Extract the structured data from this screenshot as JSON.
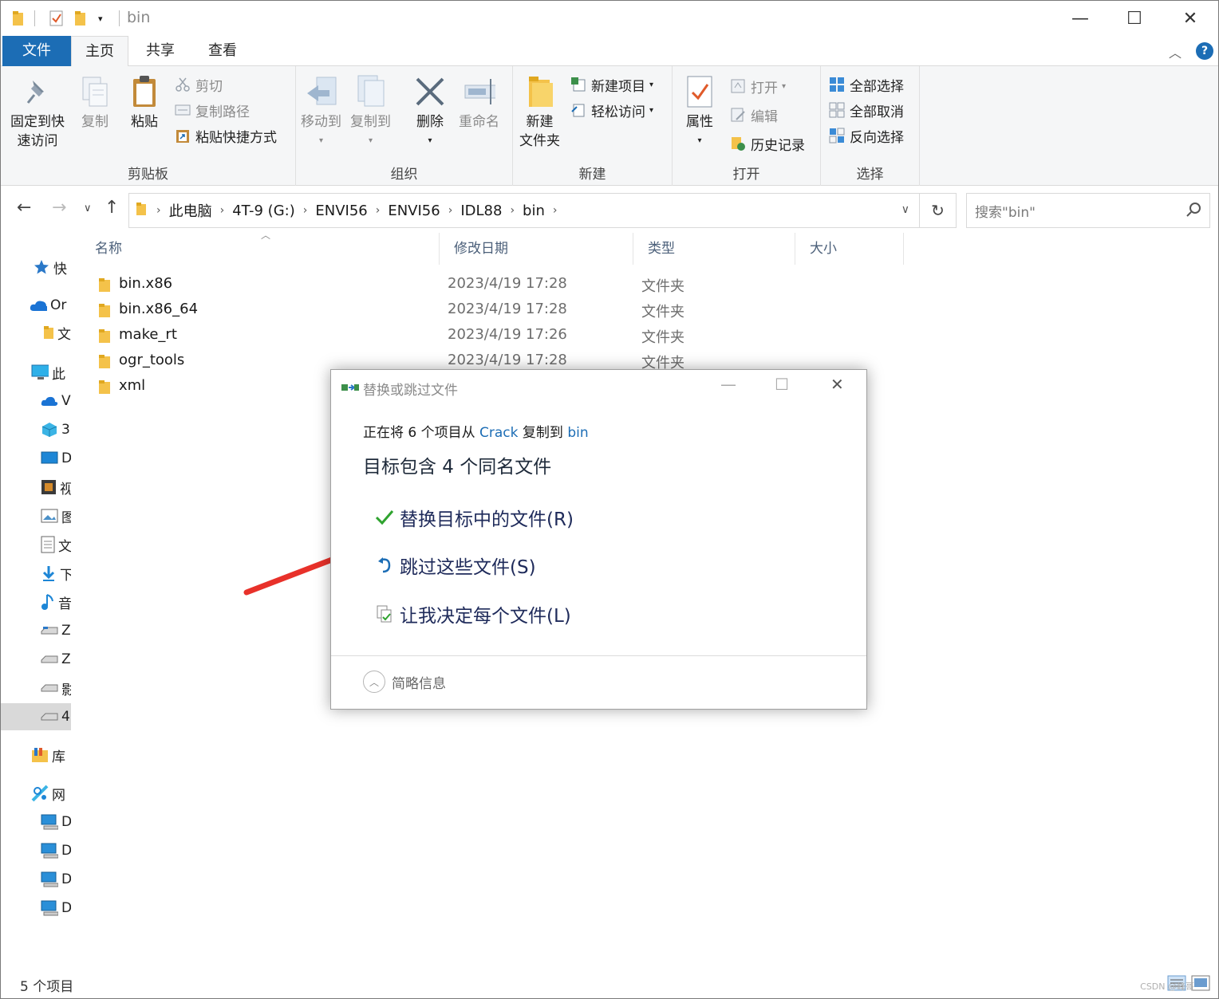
{
  "window": {
    "title": "bin",
    "controls": {
      "minimize": "—",
      "maximize": "☐",
      "close": "✕"
    }
  },
  "ribbon_tabs": [
    "文件",
    "主页",
    "共享",
    "查看"
  ],
  "ribbon": {
    "clipboard": {
      "label": "剪贴板",
      "pin": "固定到快速访问",
      "pin_l1": "固定到快",
      "pin_l2": "速访问",
      "copy": "复制",
      "paste": "粘贴",
      "cut": "剪切",
      "copy_path": "复制路径",
      "paste_shortcut": "粘贴快捷方式"
    },
    "organize": {
      "label": "组织",
      "move_to": "移动到",
      "copy_to": "复制到",
      "delete": "删除",
      "rename": "重命名"
    },
    "new": {
      "label": "新建",
      "new_folder_l1": "新建",
      "new_folder_l2": "文件夹",
      "new_item": "新建项目",
      "easy_access": "轻松访问"
    },
    "open": {
      "label": "打开",
      "properties": "属性",
      "open": "打开",
      "edit": "编辑",
      "history": "历史记录"
    },
    "select": {
      "label": "选择",
      "select_all": "全部选择",
      "select_none": "全部取消",
      "invert": "反向选择"
    }
  },
  "address": {
    "crumbs": [
      "此电脑",
      "4T-9 (G:)",
      "ENVI56",
      "ENVI56",
      "IDL88",
      "bin"
    ],
    "search_placeholder": "搜索\"bin\""
  },
  "nav_pane": [
    {
      "label": "快",
      "icon": "star-icon"
    },
    {
      "label": "Or",
      "icon": "cloud-icon"
    },
    {
      "label": "文",
      "icon": "folder-icon"
    },
    {
      "label": "此",
      "icon": "computer-icon"
    },
    {
      "label": "V",
      "icon": "cloud-icon"
    },
    {
      "label": "3",
      "icon": "cube-icon"
    },
    {
      "label": "D",
      "icon": "desktop-icon"
    },
    {
      "label": "视",
      "icon": "video-icon"
    },
    {
      "label": "图",
      "icon": "picture-icon"
    },
    {
      "label": "文",
      "icon": "document-icon"
    },
    {
      "label": "下",
      "icon": "download-icon"
    },
    {
      "label": "音",
      "icon": "music-icon"
    },
    {
      "label": "Z",
      "icon": "drive-icon"
    },
    {
      "label": "Z",
      "icon": "drive-icon"
    },
    {
      "label": "影",
      "icon": "drive-icon"
    },
    {
      "label": "4",
      "icon": "drive-icon"
    },
    {
      "label": "库",
      "icon": "library-icon"
    },
    {
      "label": "网",
      "icon": "network-icon"
    },
    {
      "label": "D",
      "icon": "pc-icon"
    },
    {
      "label": "D",
      "icon": "pc-icon"
    },
    {
      "label": "D",
      "icon": "pc-icon"
    },
    {
      "label": "D",
      "icon": "pc-icon"
    }
  ],
  "columns": {
    "name": "名称",
    "date": "修改日期",
    "type": "类型",
    "size": "大小"
  },
  "files": [
    {
      "name": "bin.x86",
      "date": "2023/4/19 17:28",
      "type": "文件夹"
    },
    {
      "name": "bin.x86_64",
      "date": "2023/4/19 17:28",
      "type": "文件夹"
    },
    {
      "name": "make_rt",
      "date": "2023/4/19 17:26",
      "type": "文件夹"
    },
    {
      "name": "ogr_tools",
      "date": "2023/4/19 17:28",
      "type": "文件夹"
    },
    {
      "name": "xml",
      "date": "",
      "type": ""
    }
  ],
  "status": {
    "count": "5 个项目"
  },
  "dialog": {
    "title": "替换或跳过文件",
    "msg_prefix": "正在将 6 个项目从 ",
    "msg_src": "Crack",
    "msg_mid": " 复制到 ",
    "msg_dst": "bin",
    "heading": "目标包含 4 个同名文件",
    "opt_replace": "替换目标中的文件(R)",
    "opt_skip": "跳过这些文件(S)",
    "opt_decide": "让我决定每个文件(L)",
    "details": "简略信息"
  },
  "colors": {
    "accent": "#1c6db5",
    "arrow": "#e8312a",
    "check": "#2fa32f"
  },
  "watermark": "CSDN @峰哥"
}
